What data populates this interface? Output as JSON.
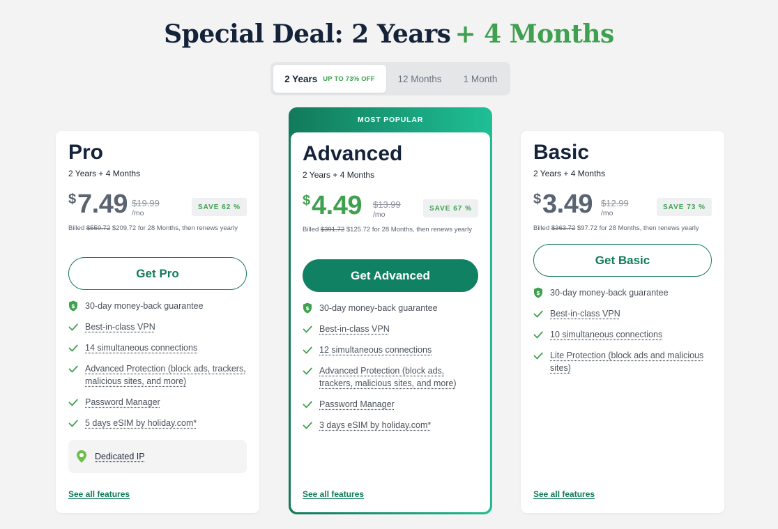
{
  "headline": {
    "main": "Special Deal: 2 Years",
    "accent": "+ 4 Months"
  },
  "billing_toggle": {
    "options": [
      {
        "label": "2 Years",
        "tag": "UP TO 73% OFF",
        "active": true
      },
      {
        "label": "12 Months",
        "active": false
      },
      {
        "label": "1 Month",
        "active": false
      }
    ]
  },
  "colors": {
    "brand_green": "#127a5b",
    "price_green": "#3fa04f",
    "price_gray": "#5a6470",
    "background": "#f3f3f3"
  },
  "plans": {
    "pro": {
      "name": "Pro",
      "term": "2 Years + 4 Months",
      "currency": "$",
      "price": "7.49",
      "old_price": "$19.99",
      "per": "/mo",
      "save": "SAVE 62 %",
      "billed_prefix": "Billed",
      "billed_old": "$559.72",
      "billed_rest": "$209.72 for 28 Months, then renews yearly",
      "cta": "Get Pro",
      "features": [
        {
          "icon": "shield-dollar-icon",
          "text": "30-day money-back guarantee"
        },
        {
          "icon": "check-icon",
          "text": "Best-in-class VPN"
        },
        {
          "icon": "check-icon",
          "text": "14 simultaneous connections"
        },
        {
          "icon": "check-icon",
          "text": "Advanced Protection (block ads, trackers, malicious sites, and more)"
        },
        {
          "icon": "check-icon",
          "text": "Password Manager"
        },
        {
          "icon": "check-icon",
          "text": "5 days eSIM by holiday.com*"
        }
      ],
      "addon": {
        "icon": "location-pin-icon",
        "label": "Dedicated IP"
      },
      "see_all": "See all features"
    },
    "advanced": {
      "ribbon": "MOST POPULAR",
      "name": "Advanced",
      "term": "2 Years + 4 Months",
      "currency": "$",
      "price": "4.49",
      "old_price": "$13.99",
      "per": "/mo",
      "save": "SAVE 67 %",
      "billed_prefix": "Billed",
      "billed_old": "$391.72",
      "billed_rest": "$125.72 for 28 Months, then renews yearly",
      "cta": "Get Advanced",
      "features": [
        {
          "icon": "shield-dollar-icon",
          "text": "30-day money-back guarantee"
        },
        {
          "icon": "check-icon",
          "text": "Best-in-class VPN"
        },
        {
          "icon": "check-icon",
          "text": "12 simultaneous connections"
        },
        {
          "icon": "check-icon",
          "text": "Advanced Protection (block ads, trackers, malicious sites, and more)"
        },
        {
          "icon": "check-icon",
          "text": "Password Manager"
        },
        {
          "icon": "check-icon",
          "text": "3 days eSIM by holiday.com*"
        }
      ],
      "see_all": "See all features"
    },
    "basic": {
      "name": "Basic",
      "term": "2 Years + 4 Months",
      "currency": "$",
      "price": "3.49",
      "old_price": "$12.99",
      "per": "/mo",
      "save": "SAVE 73 %",
      "billed_prefix": "Billed",
      "billed_old": "$363.72",
      "billed_rest": "$97.72 for 28 Months, then renews yearly",
      "cta": "Get Basic",
      "features": [
        {
          "icon": "shield-dollar-icon",
          "text": "30-day money-back guarantee"
        },
        {
          "icon": "check-icon",
          "text": "Best-in-class VPN"
        },
        {
          "icon": "check-icon",
          "text": "10 simultaneous connections"
        },
        {
          "icon": "check-icon",
          "text": "Lite Protection (block ads and malicious sites)"
        }
      ],
      "see_all": "See all features"
    }
  }
}
